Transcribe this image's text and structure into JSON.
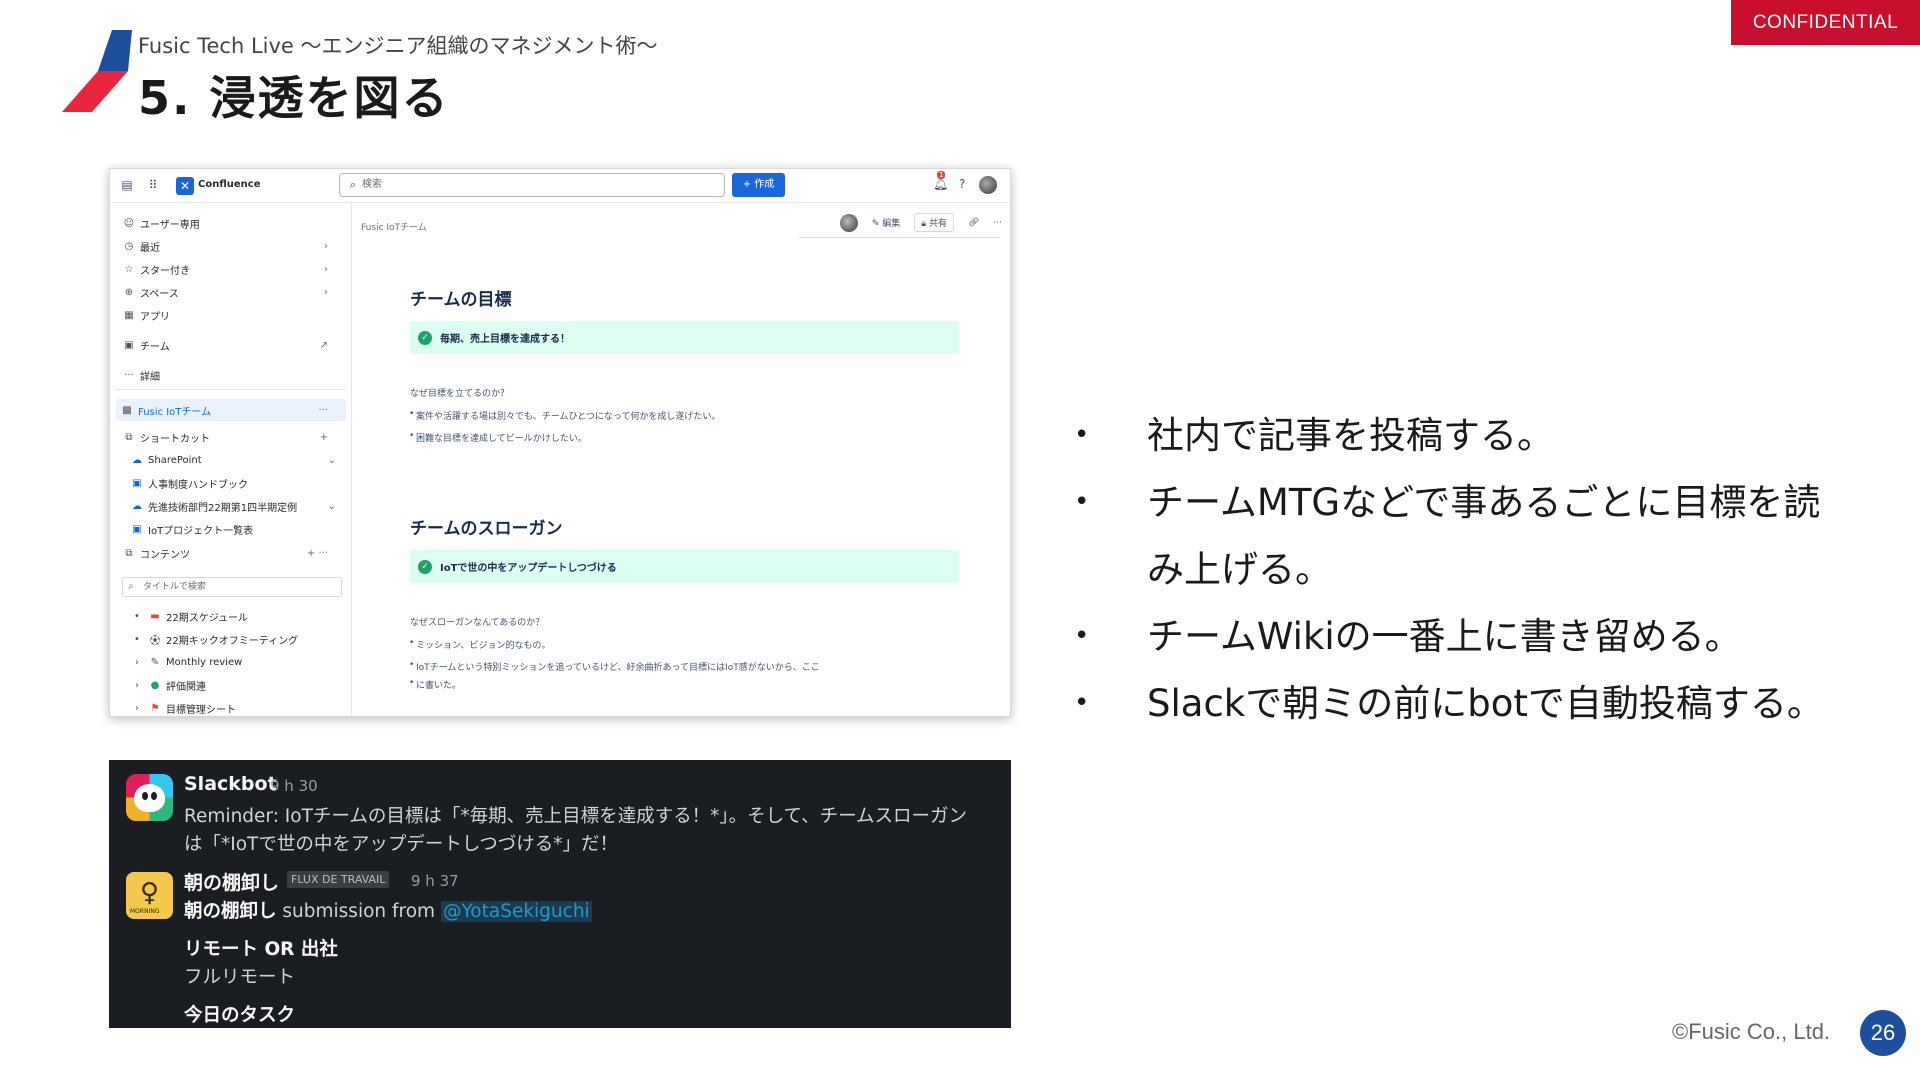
{
  "header": {
    "subtitle": "Fusic Tech Live 〜エンジニア組織のマネジメント術〜",
    "title": "5. 浸透を図る",
    "confidential": "CONFIDENTIAL",
    "accent_colors": {
      "red": "#e8263e",
      "blue": "#1d4f9c"
    }
  },
  "confluence": {
    "app_name": "Confluence",
    "search_placeholder": "検索",
    "create_label": "+ 作成",
    "notif_count": "1",
    "sidebar": {
      "items": [
        {
          "icon": "user-icon",
          "label": "ユーザー専用"
        },
        {
          "icon": "clock-icon",
          "label": "最近"
        },
        {
          "icon": "star-icon",
          "label": "スター付き"
        },
        {
          "icon": "globe-icon",
          "label": "スペース"
        },
        {
          "icon": "apps-icon",
          "label": "アプリ"
        },
        {
          "icon": "team-icon",
          "label": "チーム"
        },
        {
          "icon": "more-icon",
          "label": "詳細"
        }
      ],
      "space_name": "Fusic IoTチーム",
      "shortcuts_label": "ショートカット",
      "shortcuts": [
        {
          "icon": "cloud-icon",
          "label": "SharePoint"
        },
        {
          "icon": "doc-icon",
          "label": "人事制度ハンドブック"
        },
        {
          "icon": "cloud-icon",
          "label": "先進技術部門22期第1四半期定例"
        },
        {
          "icon": "doc-icon",
          "label": "IoTプロジェクト一覧表"
        }
      ],
      "content_label": "コンテンツ",
      "filter_placeholder": "タイトルで検索",
      "tree": [
        {
          "label": "22期スケジュール"
        },
        {
          "label": "22期キックオフミーティング"
        },
        {
          "label": "Monthly review"
        },
        {
          "label": "評価関連"
        },
        {
          "label": "目標管理シート"
        }
      ]
    },
    "breadcrumb": "Fusic IoTチーム",
    "actions": {
      "edit": "編集",
      "share": "共有"
    },
    "page": {
      "goal_heading": "チームの目標",
      "goal_panel": "毎期、売上目標を達成する！",
      "goal_question": "なぜ目標を立てるのか？",
      "goal_points": [
        "案件や活躍する場は別々でも、チームひとつになって何かを成し遂げたい。",
        "困難な目標を達成してビールかけしたい。"
      ],
      "slogan_heading": "チームのスローガン",
      "slogan_panel": "IoTで世の中をアップデートしつづける",
      "slogan_question": "なぜスローガンなんてあるのか？",
      "slogan_points": [
        "ミッション、ビジョン的なもの。",
        "IoTチームという特別ミッションを追っているけど、紆余曲折あって目標にはIoT感がないから、ここ",
        "に書いた。"
      ]
    }
  },
  "slack": {
    "msg1": {
      "name": "Slackbot",
      "time": "9 h 30",
      "line1": "Reminder: IoTチームの目標は「*毎期、売上目標を達成する！*」。そして、チームスローガン",
      "line2": "は「*IoTで世の中をアップデートしつづける*」だ！"
    },
    "msg2": {
      "name": "朝の棚卸し",
      "tag": "FLUX DE TRAVAIL",
      "time": "9 h 37",
      "submission_prefix": "朝の棚卸し",
      "submission_from": " submission from ",
      "mention": "@YotaSekiguchi",
      "field1_label": "リモート OR 出社",
      "field1_value": "フルリモート",
      "field2_label": "今日のタスク",
      "avatar_caption": "MORNING"
    }
  },
  "bullets": [
    "社内で記事を投稿する。",
    "チームMTGなどで事あるごとに目標を読",
    "み上げる。",
    "チームWikiの一番上に書き留める。",
    "Slackで朝ミの前にbotで自動投稿する。"
  ],
  "footer": {
    "copyright": "©Fusic Co., Ltd.",
    "page_number": "26"
  }
}
